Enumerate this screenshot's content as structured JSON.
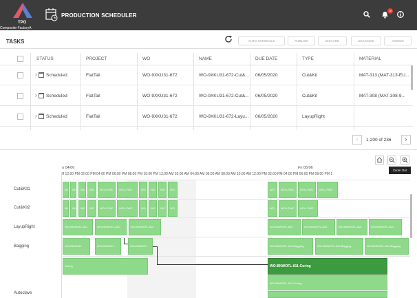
{
  "header": {
    "logo_text": "TPO",
    "logo_sub": "Composite-FactoryA",
    "app_title": "PRODUCTION SCHEDULER",
    "notification_count": "18",
    "icons": [
      "search-icon",
      "bell-icon",
      "info-icon"
    ]
  },
  "tasks": {
    "title": "TASKS",
    "toolbar": [
      "AUTO SCHEDULE",
      "PUBLISH",
      "DISCARD",
      "UNASSIGN",
      "ASSIGN"
    ],
    "columns": [
      "STATUS",
      "PROJECT",
      "WO",
      "NAME",
      "DUE DATE",
      "TYPE",
      "MATERIAL"
    ],
    "rows": [
      {
        "status": "Scheduled",
        "project": "FlatTail",
        "wo": "WO-9XKU31-672",
        "name": "WO-9XKU31-672-Cut&...",
        "due": "06/05/2020",
        "type": "Cut&Kit",
        "material": "MAT-313 (MAT-313-EU..."
      },
      {
        "status": "Scheduled",
        "project": "FlatTail",
        "wo": "WO-9XKU31-672",
        "name": "WO-9XKU31-672-Cut&...",
        "due": "06/05/2020",
        "type": "Cut&Kit",
        "material": "MAT-308 (MAT-308-9..."
      },
      {
        "status": "Scheduled",
        "project": "FlatTail",
        "wo": "WO-9XKU31-672",
        "name": "WO-9XKU31-672-Layu...",
        "due": "06/05/2020",
        "type": "LayupRight",
        "material": ""
      }
    ],
    "pager": "1-200 of 236"
  },
  "gantt": {
    "zoom_tooltip": "Zoom Out",
    "day1": "u 04/06",
    "day2": "Fri 05/06",
    "hours": "M 12:00 PM 02:00 PM 04:00 PM 06:00 PM 08:00 PM 10:00 PM 12:00 AM 02:00 AM 04:00 AM 06:00 AM 08:00 AM 10:00 AM 12:00 PM 02:00 PM 04:00 PM 06:00 PM 08:00 PM 1",
    "resources": [
      "Cut&Kit1",
      "Cut&Kit2",
      "LayupRight",
      "Bagging",
      "Autoclave"
    ],
    "cutkit1_left": [
      "WO",
      "WO",
      "WO",
      "WO",
      "WO-LFWC",
      "WO-LFWC",
      "WO",
      "WO",
      "WO",
      "WO"
    ],
    "cutkit1_right": [
      "WO",
      "WO-LFWC",
      "WO-LFWC",
      "WO-LFWC"
    ],
    "cutkit2_left": [
      "WO",
      "WO",
      "WO",
      "WO",
      "WO-LFWC",
      "WO-LFWC",
      "WO",
      "WO",
      "WO",
      "WO"
    ],
    "cutkit2_right": [
      "WO",
      "WO-LFWC",
      "WO-LFWC"
    ],
    "layup_left": [
      "WO-BNWOFL-811",
      "WO-BNWOFL-811",
      "WO-BNWOFL-812"
    ],
    "layup_right": [
      "WO-BNWOFL-809",
      "WO-BNWOFL-810",
      "WO-BNWOFL-810",
      "WO-BNWOFL-810"
    ],
    "bagging_left": [
      "WO-BNWOFL",
      "WO-BNWOFL",
      "WO-BNWOFL"
    ],
    "bagging_right": [
      "WO-BNWOFL-811-Bagging",
      "WO-BNWOFL-810-Bagging",
      "WO-BNWOFL-811-Bagging"
    ],
    "autoclave_left": "Curing",
    "autoclave_main": "WO-BNWOFL-811-Curing",
    "autoclave_second": "WO-BNWOFL-812-Curing"
  }
}
